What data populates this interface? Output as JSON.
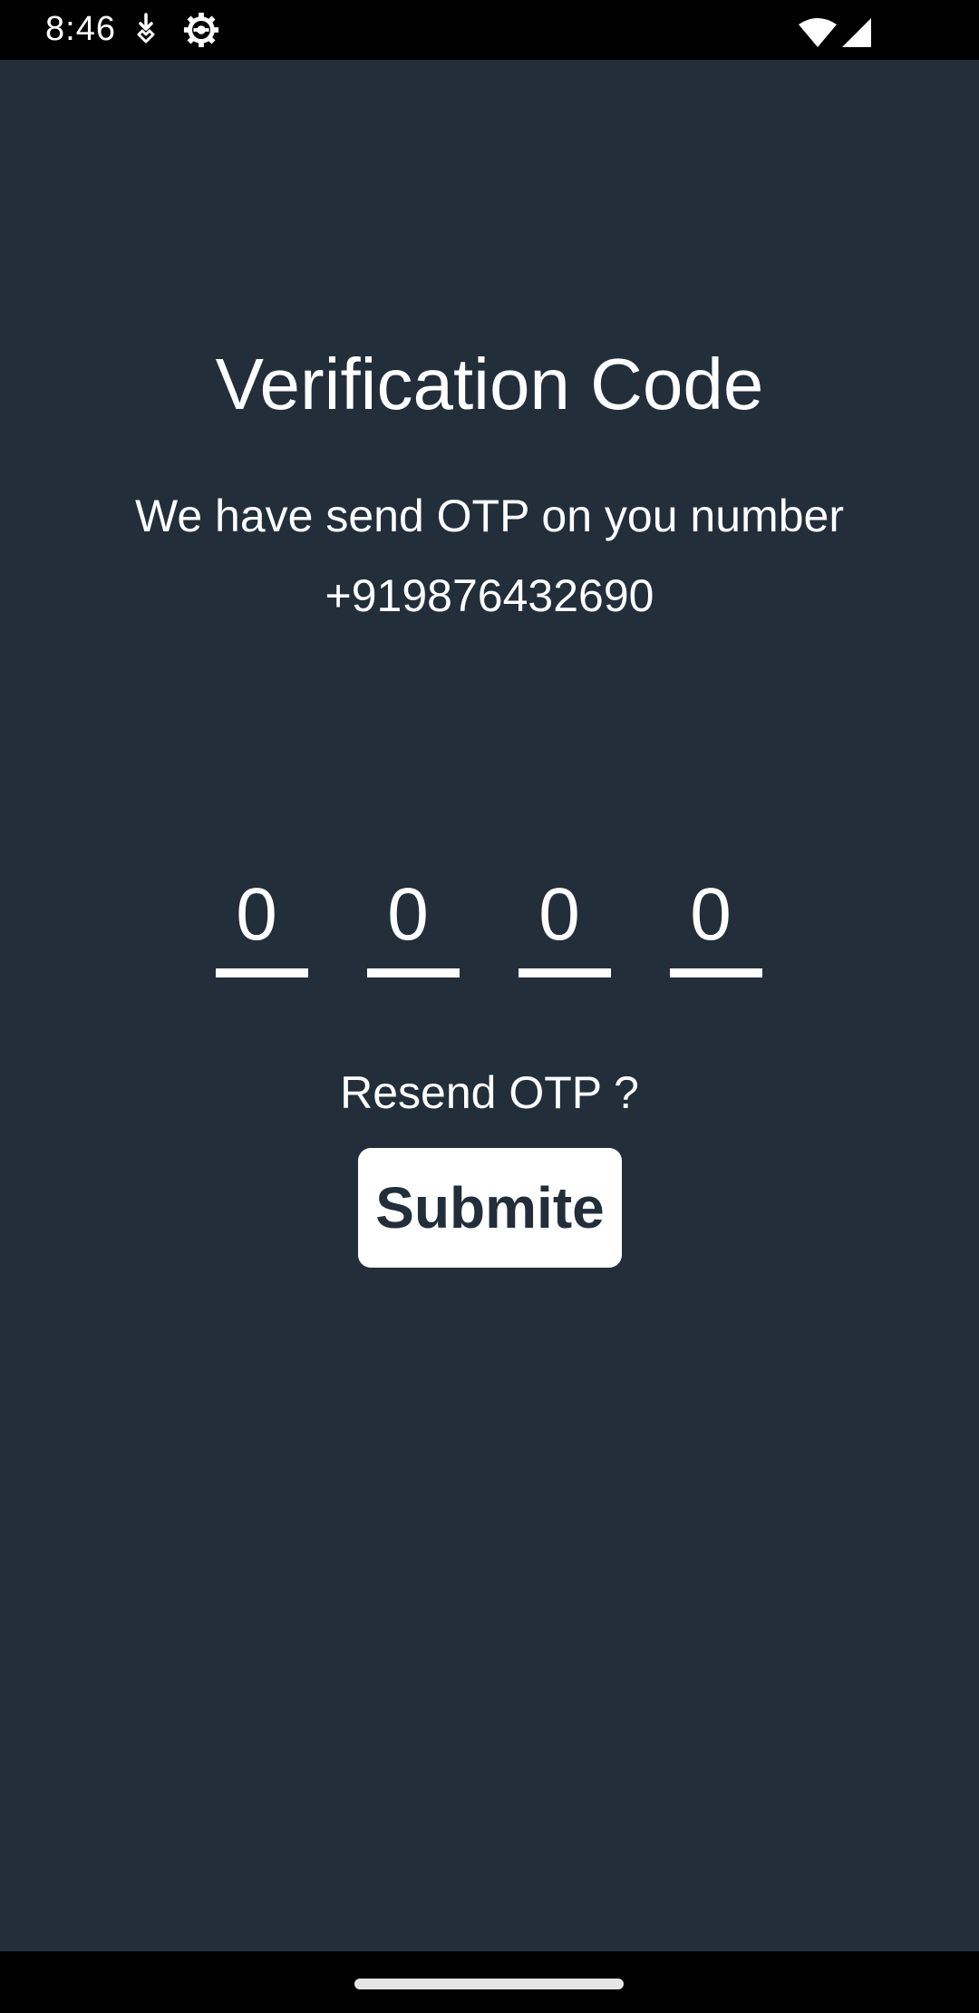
{
  "status_bar": {
    "time": "8:46",
    "icons": [
      "download-notification-icon",
      "settings-gear-icon",
      "wifi-icon",
      "cell-signal-icon"
    ]
  },
  "screen": {
    "title": "Verification Code",
    "message": "We have send OTP on you number",
    "phone_number": "+919876432690",
    "otp_digits": [
      "0",
      "0",
      "0",
      "0"
    ],
    "resend_label": "Resend OTP ?",
    "submit_label": "Submite"
  },
  "colors": {
    "background": "#232e3b",
    "text": "#ffffff",
    "button_bg": "#ffffff",
    "button_text": "#232e3b"
  }
}
